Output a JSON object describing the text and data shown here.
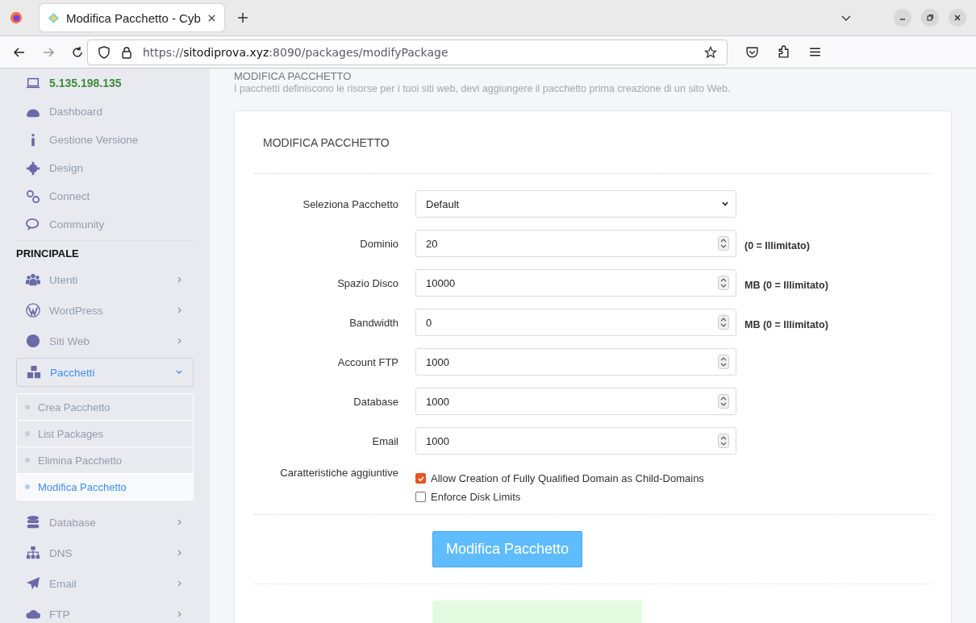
{
  "browser": {
    "tab_title": "Modifica Pacchetto - Cyb",
    "url_scheme": "https://",
    "url_host": "sitodiprova.xyz",
    "url_path": ":8090/packages/modifyPackage"
  },
  "sidebar": {
    "ip": "5.135.198.135",
    "top_items": [
      {
        "label": "Dashboard"
      },
      {
        "label": "Gestione Versione"
      },
      {
        "label": "Design"
      },
      {
        "label": "Connect"
      },
      {
        "label": "Community"
      }
    ],
    "section": "PRINCIPALE",
    "items": [
      {
        "label": "Utenti",
        "expanded": false
      },
      {
        "label": "WordPress",
        "expanded": false
      },
      {
        "label": "Siti Web",
        "expanded": false
      },
      {
        "label": "Pacchetti",
        "expanded": true,
        "children": [
          {
            "label": "Crea Pacchetto",
            "selected": false
          },
          {
            "label": "List Packages",
            "selected": false
          },
          {
            "label": "Elimina Pacchetto",
            "selected": false
          },
          {
            "label": "Modifica Pacchetto",
            "selected": true
          }
        ]
      },
      {
        "label": "Database",
        "expanded": false
      },
      {
        "label": "DNS",
        "expanded": false
      },
      {
        "label": "Email",
        "expanded": false
      },
      {
        "label": "FTP",
        "expanded": false
      }
    ]
  },
  "page": {
    "title": "MODIFICA PACCHETTO",
    "description": "I pacchetti definiscono le risorse per i tuoi siti web, devi aggiungere il pacchetto prima creazione di un sito Web."
  },
  "card": {
    "title": "MODIFICA PACCHETTO",
    "fields": [
      {
        "kind": "select",
        "label": "Seleziona Pacchetto",
        "value": "Default"
      },
      {
        "kind": "number",
        "label": "Dominio",
        "value": "20",
        "hint": "(0 = Illimitato)"
      },
      {
        "kind": "number",
        "label": "Spazio Disco",
        "value": "10000",
        "hint": "MB (0 = Illimitato)"
      },
      {
        "kind": "number",
        "label": "Bandwidth",
        "value": "0",
        "hint": "MB (0 = Illimitato)"
      },
      {
        "kind": "number",
        "label": "Account FTP",
        "value": "1000"
      },
      {
        "kind": "number",
        "label": "Database",
        "value": "1000"
      },
      {
        "kind": "number",
        "label": "Email",
        "value": "1000"
      }
    ],
    "features_label": "Caratteristiche aggiuntive",
    "features": [
      {
        "label": "Allow Creation of Fully Qualified Domain as Child-Domains",
        "checked": true
      },
      {
        "label": "Enforce Disk Limits",
        "checked": false
      }
    ],
    "button": "Modifica Pacchetto"
  }
}
